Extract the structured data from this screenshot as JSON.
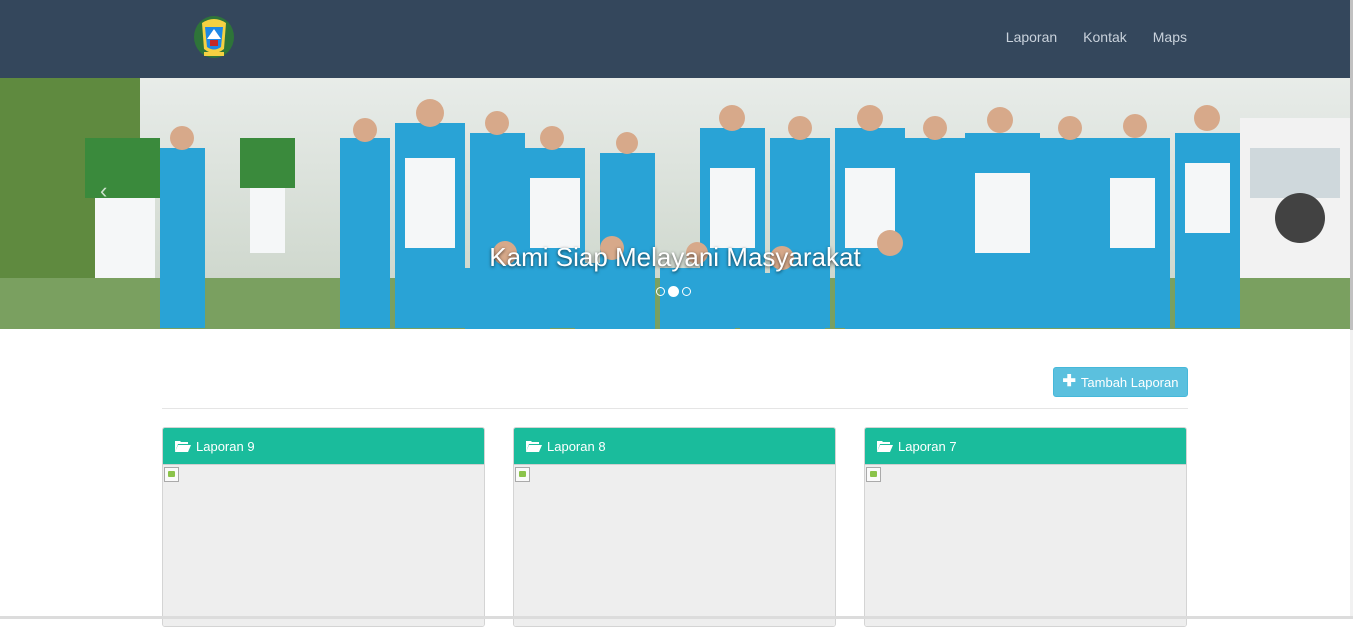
{
  "navbar": {
    "logo_icon": "regency-emblem-icon",
    "links": [
      "Laporan",
      "Kontak",
      "Maps"
    ]
  },
  "carousel": {
    "caption": "Kami Siap Melayani Masyarakat",
    "prev_icon": "chevron-left-icon",
    "indicators": 3,
    "active_index": 1
  },
  "actions": {
    "add_label": "Tambah Laporan",
    "add_icon": "plus-icon"
  },
  "cards": [
    {
      "title": "Laporan 9",
      "icon": "folder-open-icon"
    },
    {
      "title": "Laporan 8",
      "icon": "folder-open-icon"
    },
    {
      "title": "Laporan 7",
      "icon": "folder-open-icon"
    }
  ],
  "colors": {
    "navbar": "#34475c",
    "card_header": "#1abc9c",
    "button": "#5bc0de"
  }
}
